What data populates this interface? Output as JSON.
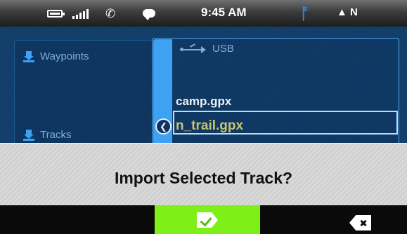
{
  "status_bar": {
    "time": "9:45 AM",
    "compass": "N",
    "icons": [
      "battery-icon",
      "signal-icon",
      "phone-icon",
      "chat-icon",
      "bluetooth-icon",
      "compass-icon"
    ],
    "bluetooth_color": "#2b8cf0"
  },
  "left_panel": {
    "items": [
      {
        "label": "Waypoints",
        "icon": "download-icon"
      },
      {
        "label": "Tracks",
        "icon": "download-icon"
      }
    ]
  },
  "right_panel": {
    "location": "USB",
    "files": [
      {
        "name": "camp.gpx"
      },
      {
        "name": "n_trail.gpx",
        "selected": true
      }
    ]
  },
  "dialog": {
    "message": "Import Selected Track?",
    "confirm_color": "#7ef018"
  }
}
